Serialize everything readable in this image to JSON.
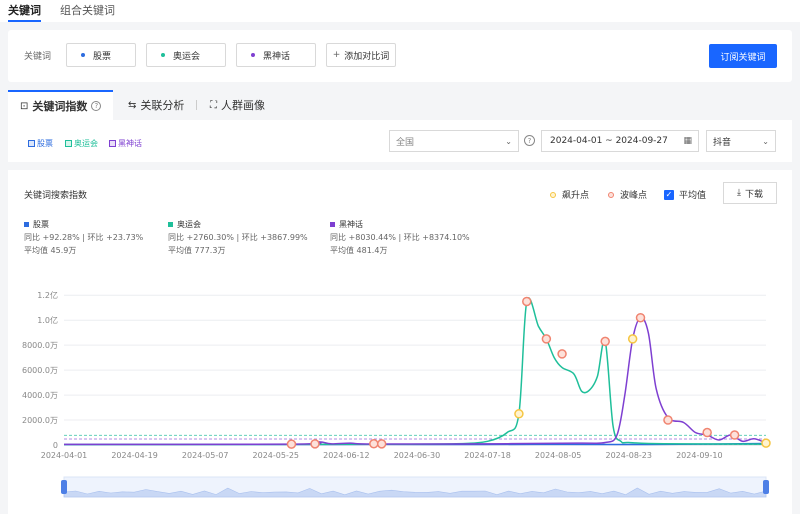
{
  "top_tabs": {
    "active": "关键词",
    "inactive": "组合关键词"
  },
  "keywords": {
    "label": "关键词",
    "chips": [
      {
        "name": "股票",
        "color": "#2d6cdf"
      },
      {
        "name": "奥运会",
        "color": "#1fbf9a"
      },
      {
        "name": "黑神话",
        "color": "#7e3fd1"
      }
    ],
    "add_label": "添加对比词",
    "subscribe_label": "订阅关键词"
  },
  "tabs": [
    {
      "label": "关键词指数",
      "icon": "chart-icon"
    },
    {
      "label": "关联分析",
      "icon": "relation-icon"
    },
    {
      "label": "人群画像",
      "icon": "portrait-icon"
    }
  ],
  "filters": {
    "legend": [
      "股票",
      "奥运会",
      "黑神话"
    ],
    "region": "全国",
    "date_range": "2024-04-01 ~ 2024-09-27",
    "platform": "抖音"
  },
  "chart_panel": {
    "title": "关键词搜索指数",
    "controls": {
      "surge": "飙升点",
      "peak": "波峰点",
      "avg": "平均值",
      "download": "下载"
    },
    "stats": [
      {
        "name": "股票",
        "color": "#2d6cdf",
        "yoy_mom": "同比 +92.28% | 环比 +23.73%",
        "avg": "平均值 45.9万"
      },
      {
        "name": "奥运会",
        "color": "#1fbf9a",
        "yoy_mom": "同比 +2760.30% | 环比 +3867.99%",
        "avg": "平均值 777.3万"
      },
      {
        "name": "黑神话",
        "color": "#7e3fd1",
        "yoy_mom": "同比 +8030.44% | 环比 +8374.10%",
        "avg": "平均值 481.4万"
      }
    ]
  },
  "colors": {
    "accent": "#1966ff",
    "surge": "#f5c542",
    "peak": "#f08470"
  },
  "chart_data": {
    "type": "line",
    "x_start": "2024-04-01",
    "x_end": "2024-09-27",
    "x_ticks": [
      "2024-04-01",
      "2024-04-19",
      "2024-05-07",
      "2024-05-25",
      "2024-06-12",
      "2024-06-30",
      "2024-07-18",
      "2024-08-05",
      "2024-08-23",
      "2024-09-10"
    ],
    "y_ticks": [
      {
        "value": 0,
        "label": "0"
      },
      {
        "value": 20000000,
        "label": "2000.0万"
      },
      {
        "value": 40000000,
        "label": "4000.0万"
      },
      {
        "value": 60000000,
        "label": "6000.0万"
      },
      {
        "value": 80000000,
        "label": "8000.0万"
      },
      {
        "value": 100000000,
        "label": "1.0亿"
      },
      {
        "value": 120000000,
        "label": "1.2亿"
      }
    ],
    "ylim": [
      0,
      125000000
    ],
    "grid": true,
    "series": [
      {
        "name": "股票",
        "color": "#2d6cdf",
        "points": [
          [
            "2024-04-01",
            300000
          ],
          [
            "2024-04-20",
            400000
          ],
          [
            "2024-05-10",
            400000
          ],
          [
            "2024-05-30",
            400000
          ],
          [
            "2024-06-20",
            500000
          ],
          [
            "2024-07-10",
            400000
          ],
          [
            "2024-07-30",
            500000
          ],
          [
            "2024-08-20",
            400000
          ],
          [
            "2024-09-05",
            600000
          ],
          [
            "2024-09-27",
            1200000
          ]
        ]
      },
      {
        "name": "奥运会",
        "color": "#1fbf9a",
        "points": [
          [
            "2024-04-01",
            400000
          ],
          [
            "2024-05-20",
            500000
          ],
          [
            "2024-06-20",
            600000
          ],
          [
            "2024-07-10",
            1000000
          ],
          [
            "2024-07-18",
            3000000
          ],
          [
            "2024-07-23",
            10000000
          ],
          [
            "2024-07-26",
            25000000
          ],
          [
            "2024-07-28",
            115000000
          ],
          [
            "2024-07-31",
            95000000
          ],
          [
            "2024-08-02",
            85000000
          ],
          [
            "2024-08-04",
            70000000
          ],
          [
            "2024-08-06",
            62000000
          ],
          [
            "2024-08-09",
            57000000
          ],
          [
            "2024-08-11",
            43000000
          ],
          [
            "2024-08-13",
            44000000
          ],
          [
            "2024-08-15",
            55000000
          ],
          [
            "2024-08-17",
            83000000
          ],
          [
            "2024-08-19",
            15000000
          ],
          [
            "2024-08-21",
            3000000
          ],
          [
            "2024-08-23",
            2000000
          ],
          [
            "2024-09-01",
            1000000
          ],
          [
            "2024-09-27",
            700000
          ]
        ]
      },
      {
        "name": "黑神话",
        "color": "#7e3fd1",
        "points": [
          [
            "2024-04-01",
            500000
          ],
          [
            "2024-05-30",
            700000
          ],
          [
            "2024-06-05",
            2500000
          ],
          [
            "2024-06-08",
            1000000
          ],
          [
            "2024-06-13",
            1500000
          ],
          [
            "2024-06-18",
            800000
          ],
          [
            "2024-07-15",
            900000
          ],
          [
            "2024-08-10",
            1500000
          ],
          [
            "2024-08-17",
            2000000
          ],
          [
            "2024-08-20",
            8000000
          ],
          [
            "2024-08-22",
            40000000
          ],
          [
            "2024-08-24",
            85000000
          ],
          [
            "2024-08-26",
            102000000
          ],
          [
            "2024-08-28",
            90000000
          ],
          [
            "2024-08-30",
            45000000
          ],
          [
            "2024-09-02",
            22000000
          ],
          [
            "2024-09-06",
            18000000
          ],
          [
            "2024-09-09",
            10000000
          ],
          [
            "2024-09-12",
            8000000
          ],
          [
            "2024-09-15",
            4000000
          ],
          [
            "2024-09-18",
            8000000
          ],
          [
            "2024-09-21",
            3000000
          ],
          [
            "2024-09-24",
            5000000
          ],
          [
            "2024-09-27",
            1500000
          ]
        ]
      }
    ],
    "peaks": [
      [
        "2024-05-29",
        700000
      ],
      [
        "2024-06-04",
        900000
      ],
      [
        "2024-06-19",
        1000000
      ],
      [
        "2024-06-21",
        900000
      ],
      [
        "2024-07-28",
        115000000
      ],
      [
        "2024-08-02",
        85000000
      ],
      [
        "2024-08-06",
        73000000
      ],
      [
        "2024-08-17",
        83000000
      ],
      [
        "2024-08-26",
        102000000
      ],
      [
        "2024-09-02",
        20000000
      ],
      [
        "2024-09-12",
        10000000
      ],
      [
        "2024-09-19",
        8000000
      ]
    ],
    "surges": [
      [
        "2024-07-26",
        25000000
      ],
      [
        "2024-08-24",
        85000000
      ],
      [
        "2024-09-27",
        1500000
      ]
    ]
  }
}
